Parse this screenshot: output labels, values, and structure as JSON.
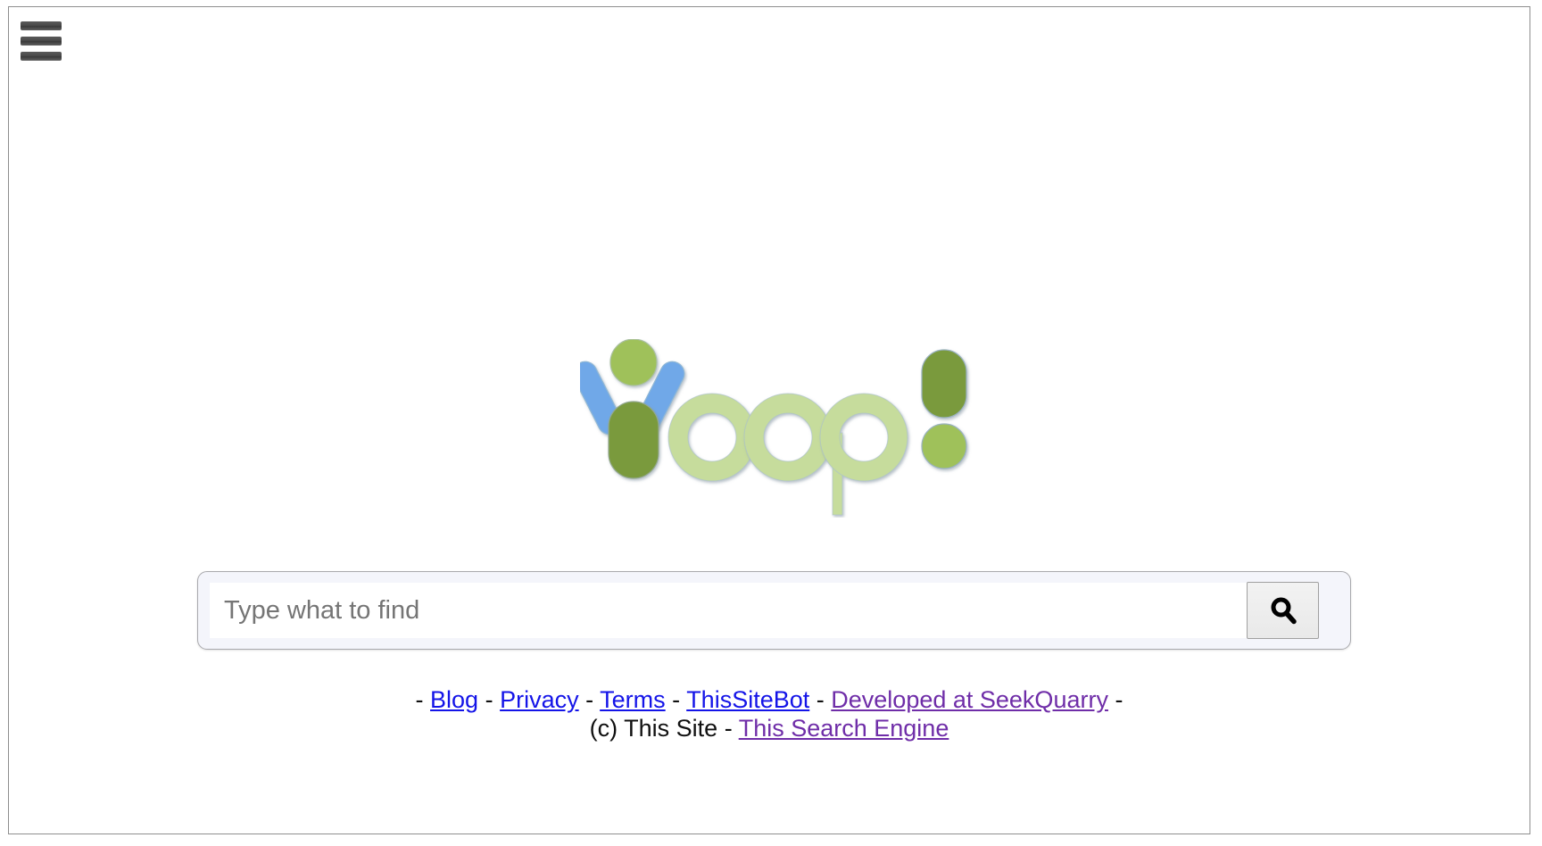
{
  "menu": {
    "hamburger_label": "Open menu",
    "icon": "hamburger-menu-icon"
  },
  "logo": {
    "name": "Yioop logo",
    "wordmark": "Yioop!",
    "colors": {
      "dark_green": "#7a9a3c",
      "light_green": "#c6dc9c",
      "mid_green": "#9fc15a",
      "blue": "#6fa8e8",
      "outline": "#9fb6c4"
    }
  },
  "search": {
    "placeholder": "Type what to find",
    "value": "",
    "button_icon": "search-icon",
    "button_label": "Search"
  },
  "footer": {
    "line1_prefix": "-",
    "line1_suffix": "-",
    "separator": "-",
    "links": [
      {
        "label": "Blog",
        "state": "unvisited"
      },
      {
        "label": "Privacy",
        "state": "unvisited"
      },
      {
        "label": "Terms",
        "state": "unvisited"
      },
      {
        "label": "ThisSiteBot",
        "state": "unvisited"
      },
      {
        "label": "Developed at SeekQuarry",
        "state": "visited"
      }
    ],
    "copyright": "(c) This Site",
    "copyright_separator": "-",
    "engine_link": {
      "label": "This Search Engine",
      "state": "visited"
    }
  }
}
